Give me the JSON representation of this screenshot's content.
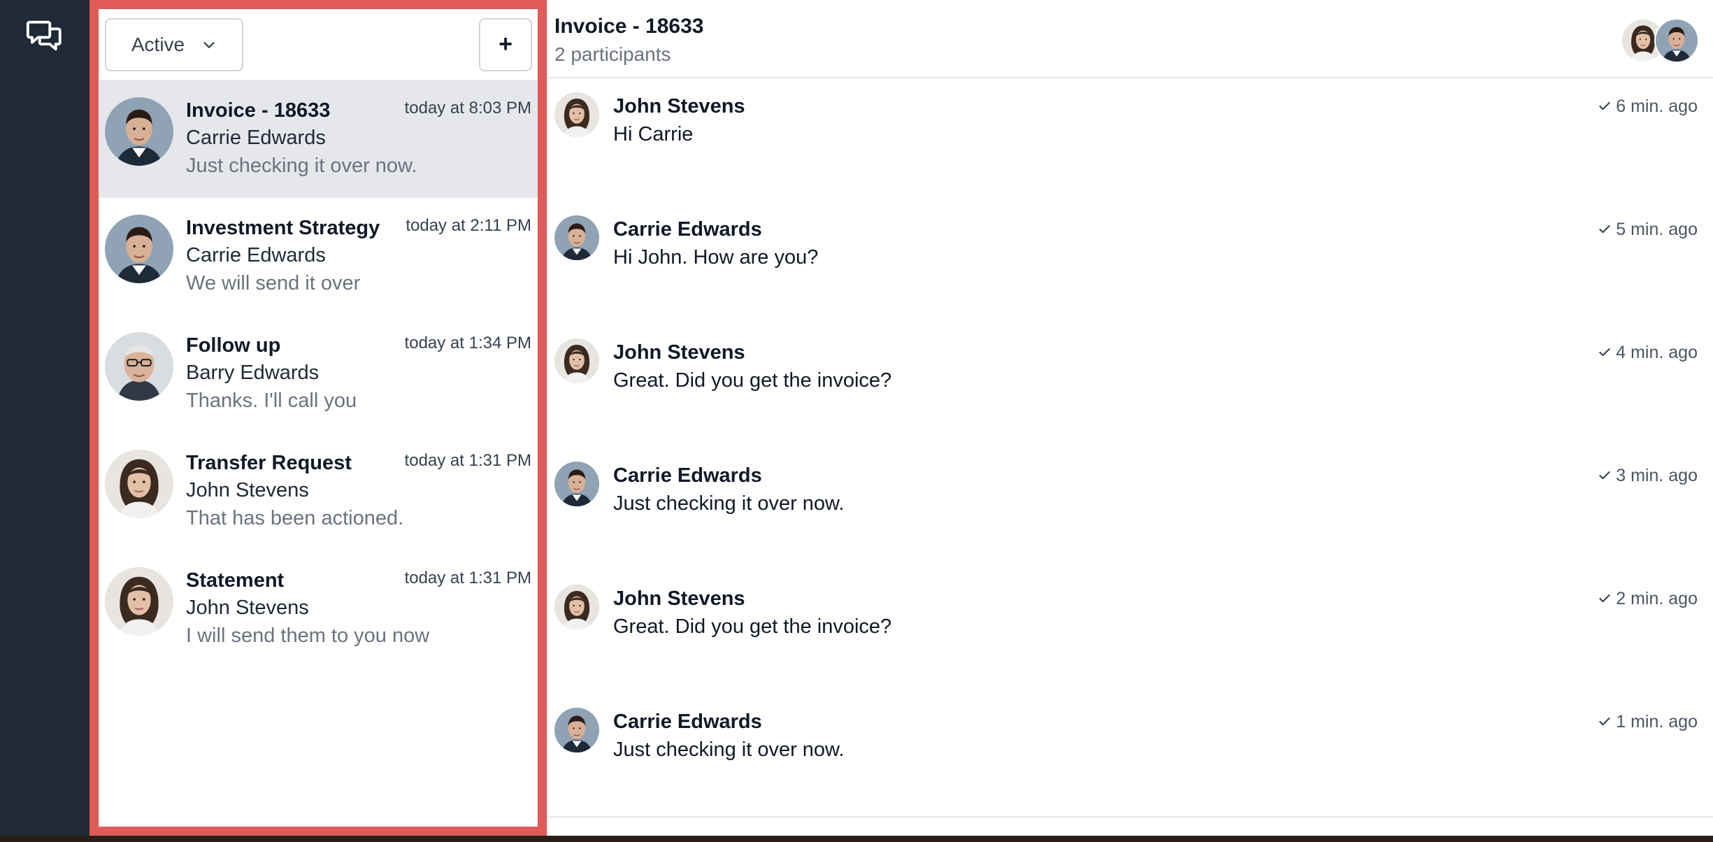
{
  "filter": {
    "label": "Active"
  },
  "new_button": {
    "label": "+"
  },
  "conversations": [
    {
      "title": "Invoice - 18633",
      "time": "today at 8:03 PM",
      "name": "Carrie Edwards",
      "preview": "Just checking it over now.",
      "avatar": "man-short-dark-hair",
      "selected": true
    },
    {
      "title": "Investment Strategy",
      "time": "today at 2:11 PM",
      "name": "Carrie Edwards",
      "preview": "We will send it over",
      "avatar": "man-short-dark-hair",
      "selected": false
    },
    {
      "title": "Follow up",
      "time": "today at 1:34 PM",
      "name": "Barry Edwards",
      "preview": "Thanks. I'll call you",
      "avatar": "older-man-glasses",
      "selected": false
    },
    {
      "title": "Transfer Request",
      "time": "today at 1:31 PM",
      "name": "John Stevens",
      "preview": "That has been actioned.",
      "avatar": "woman-dark-hair",
      "selected": false
    },
    {
      "title": "Statement",
      "time": "today at 1:31 PM",
      "name": "John Stevens",
      "preview": "I will send them to you now",
      "avatar": "woman-dark-hair",
      "selected": false
    }
  ],
  "chat": {
    "title": "Invoice - 18633",
    "subtitle": "2 participants",
    "messages": [
      {
        "author": "John Stevens",
        "text": "Hi Carrie",
        "time": "6 min. ago",
        "avatar": "woman-dark-hair"
      },
      {
        "author": "Carrie Edwards",
        "text": "Hi John. How are you?",
        "time": "5 min. ago",
        "avatar": "man-short-dark-hair"
      },
      {
        "author": "John Stevens",
        "text": "Great. Did you get the invoice?",
        "time": "4 min. ago",
        "avatar": "woman-dark-hair"
      },
      {
        "author": "Carrie Edwards",
        "text": "Just checking it over now.",
        "time": "3 min. ago",
        "avatar": "man-short-dark-hair"
      },
      {
        "author": "John Stevens",
        "text": "Great. Did you get the invoice?",
        "time": "2 min. ago",
        "avatar": "woman-dark-hair"
      },
      {
        "author": "Carrie Edwards",
        "text": "Just checking it over now.",
        "time": "1 min. ago",
        "avatar": "man-short-dark-hair"
      }
    ]
  },
  "colors": {
    "rail": "#1f2937",
    "highlight_border": "#e05a57",
    "selected_row": "#e5e7eb",
    "muted_text": "#6b7280"
  }
}
